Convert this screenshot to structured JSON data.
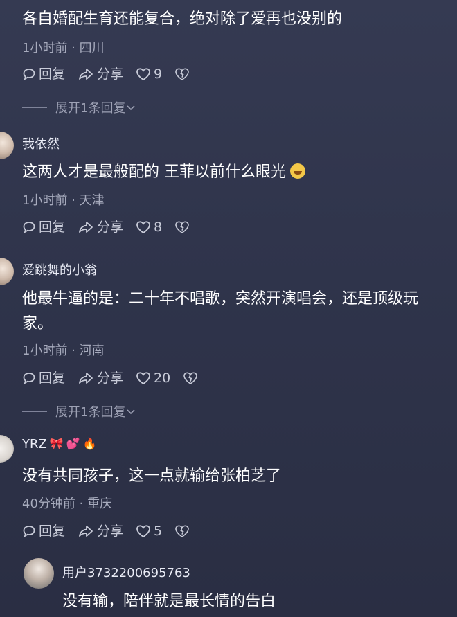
{
  "comments": [
    {
      "text": "各自婚配生育还能复合，绝对除了爱再也没别的",
      "meta": "1小时前 · 四川",
      "reply_label": "回复",
      "share_label": "分享",
      "likes": "9",
      "expand_label": "展开1条回复"
    },
    {
      "username": "我依然",
      "text": "这两人才是最般配的 王菲以前什么眼光",
      "meta": "1小时前 · 天津",
      "reply_label": "回复",
      "share_label": "分享",
      "likes": "8"
    },
    {
      "username": "爱跳舞的小翁",
      "text": "他最牛逼的是：二十年不唱歌，突然开演唱会，还是顶级玩家。",
      "meta": "1小时前 · 河南",
      "reply_label": "回复",
      "share_label": "分享",
      "likes": "20",
      "expand_label": "展开1条回复"
    },
    {
      "username": "YRZ",
      "badges": [
        "🎀",
        "💕",
        "🔥"
      ],
      "text": "没有共同孩子，这一点就输给张柏芝了",
      "meta": "40分钟前 · 重庆",
      "reply_label": "回复",
      "share_label": "分享",
      "likes": "5"
    },
    {
      "username": "用户3732200695763",
      "text": "没有输，陪伴就是最长情的告白"
    }
  ],
  "icons": {
    "reply": "speech-bubble-icon",
    "share": "share-arrow-icon",
    "like": "heart-icon",
    "dislike": "broken-heart-icon",
    "expand": "chevron-down-icon"
  }
}
